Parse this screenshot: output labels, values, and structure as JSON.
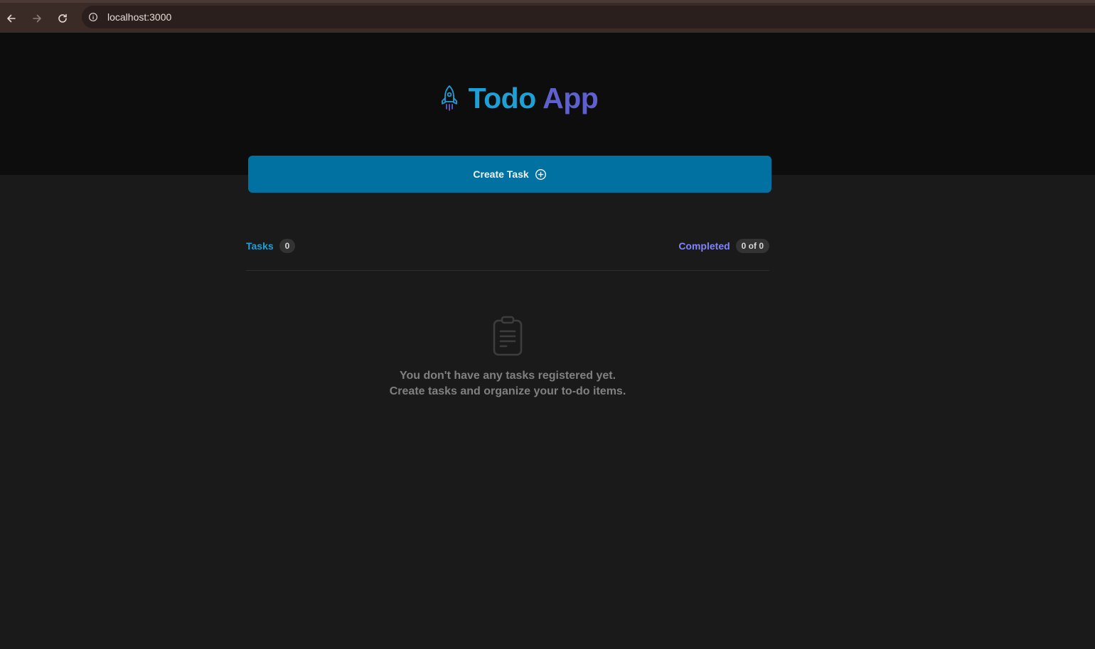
{
  "browser": {
    "url": "localhost:3000",
    "icons": {
      "back": "arrow-left-icon",
      "forward": "arrow-right-icon",
      "reload": "reload-icon",
      "site_info": "info-icon"
    }
  },
  "app": {
    "title_part1": "Todo",
    "title_part2": "App",
    "logo_icon": "rocket-icon",
    "colors": {
      "brand_blue": "#1e9fd6",
      "brand_purple": "#5e60ce",
      "button": "#0071a0",
      "header_bg": "#0d0d0d",
      "page_bg": "#1a1a1a"
    }
  },
  "create_button": {
    "label": "Create Task",
    "icon": "plus-circle-icon"
  },
  "counters": {
    "tasks_label": "Tasks",
    "tasks_count": "0",
    "completed_label": "Completed",
    "completed_count": "0 of 0"
  },
  "empty_state": {
    "icon": "clipboard-icon",
    "line1": "You don't have any tasks registered yet.",
    "line2": "Create tasks and organize your to-do items."
  }
}
